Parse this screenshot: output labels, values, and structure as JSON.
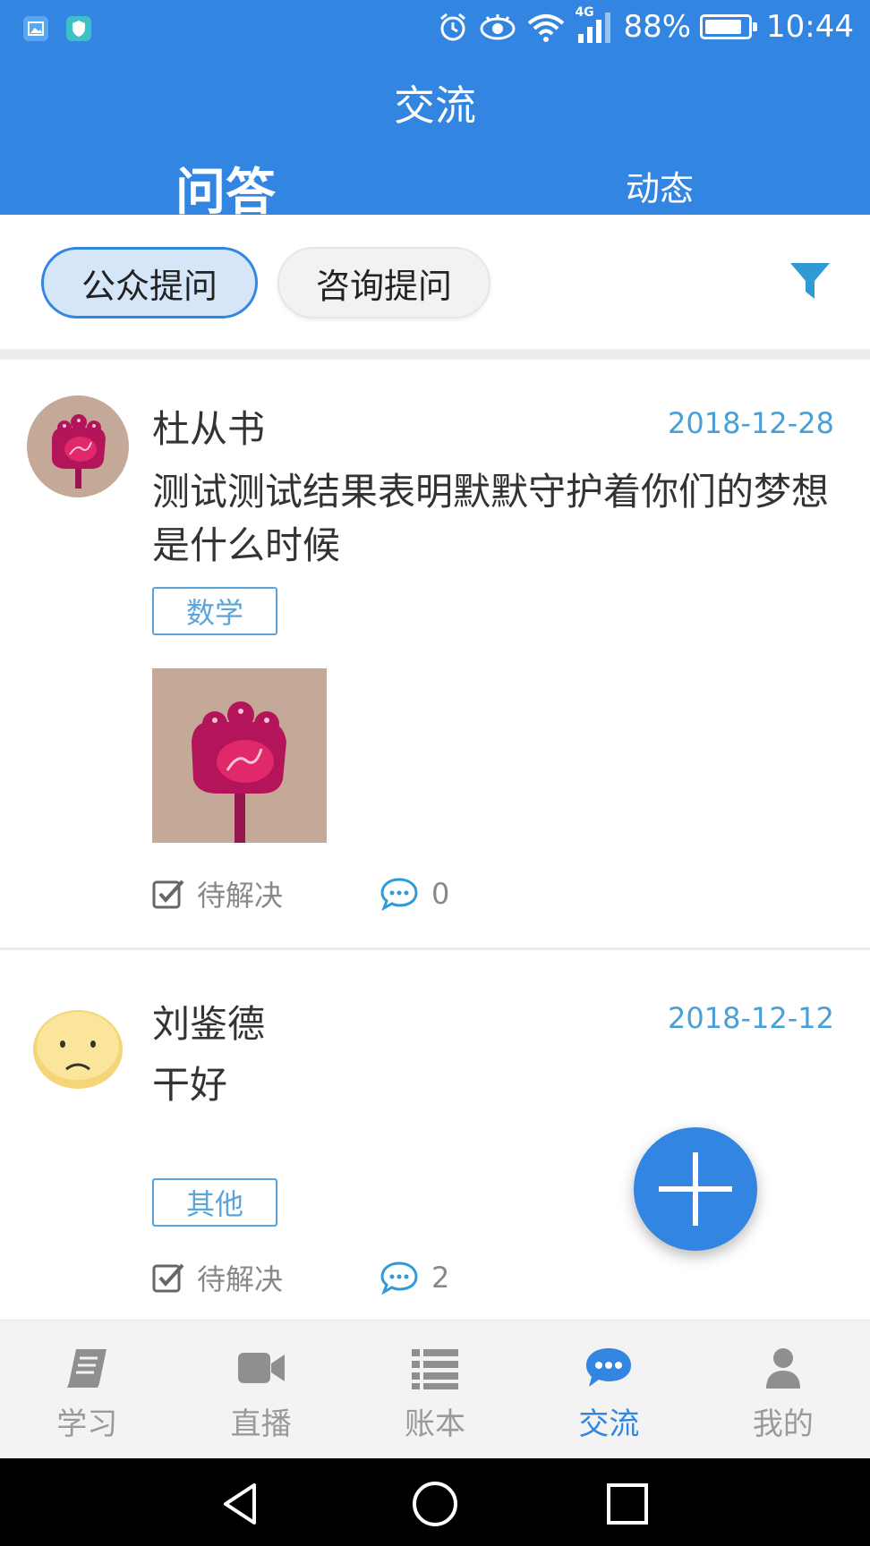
{
  "status_bar": {
    "battery": "88%",
    "battery_level": 0.88,
    "time": "10:44",
    "network": "4G",
    "left_icons": [
      "gallery-icon",
      "shield-icon"
    ],
    "right_icons": [
      "alarm-icon",
      "eye-icon",
      "wifi-icon",
      "signal-icon",
      "battery-icon"
    ]
  },
  "header": {
    "title": "交流",
    "tabs": [
      {
        "label": "问答",
        "active": true
      },
      {
        "label": "动态",
        "active": false
      }
    ],
    "color": "#3285e0"
  },
  "filters": {
    "chips": [
      {
        "label": "公众提问",
        "active": true
      },
      {
        "label": "咨询提问",
        "active": false
      }
    ],
    "filter_icon": "funnel-icon"
  },
  "posts": [
    {
      "author": "杜从书",
      "date": "2018-12-28",
      "content": "测试测试结果表明默默守护着你们的梦想是什么时候",
      "tag": "数学",
      "has_image": true,
      "status": "待解决",
      "comment_count": "0"
    },
    {
      "author": "刘鉴德",
      "date": "2018-12-12",
      "content": "干好",
      "tag": "其他",
      "has_image": false,
      "status": "待解决",
      "comment_count": "2"
    }
  ],
  "fab": {
    "icon": "plus-icon"
  },
  "bottom_nav": [
    {
      "label": "学习",
      "icon": "book-icon",
      "active": false
    },
    {
      "label": "直播",
      "icon": "video-camera-icon",
      "active": false
    },
    {
      "label": "账本",
      "icon": "list-icon",
      "active": false
    },
    {
      "label": "交流",
      "icon": "chat-bubble-icon",
      "active": true
    },
    {
      "label": "我的",
      "icon": "person-icon",
      "active": false
    }
  ],
  "system_nav": [
    "back-icon",
    "home-icon",
    "recents-icon"
  ]
}
